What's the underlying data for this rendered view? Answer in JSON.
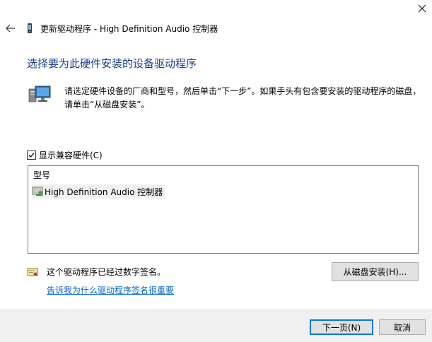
{
  "window": {
    "title": "更新驱动程序 - High Definition Audio 控制器"
  },
  "heading": "选择要为此硬件安装的设备驱动程序",
  "description": "请选定硬件设备的厂商和型号，然后单击“下一步”。如果手头有包含要安装的驱动程序的磁盘，请单击“从磁盘安装”。",
  "compatible": {
    "label": "显示兼容硬件(C)",
    "checked": true
  },
  "model_list": {
    "header": "型号",
    "items": [
      {
        "label": "High Definition Audio 控制器",
        "selected": true
      }
    ]
  },
  "signature": {
    "status": "这个驱动程序已经过数字签名。",
    "link": "告诉我为什么驱动程序签名很重要"
  },
  "buttons": {
    "have_disk": "从磁盘安装(H)...",
    "next": "下一页(N)",
    "cancel": "取消"
  },
  "icons": {
    "close": "close-icon",
    "back": "back-arrow-icon",
    "device": "device-icon",
    "hardware": "hardware-computer-icon",
    "driver_item": "driver-icon",
    "certificate": "certificate-icon"
  },
  "colors": {
    "heading": "#1a3c8e",
    "link": "#0066cc",
    "footer_bg": "#f0f0f0",
    "default_button_border": "#0078d7",
    "selected_item_bg": "#f0f0f0"
  }
}
